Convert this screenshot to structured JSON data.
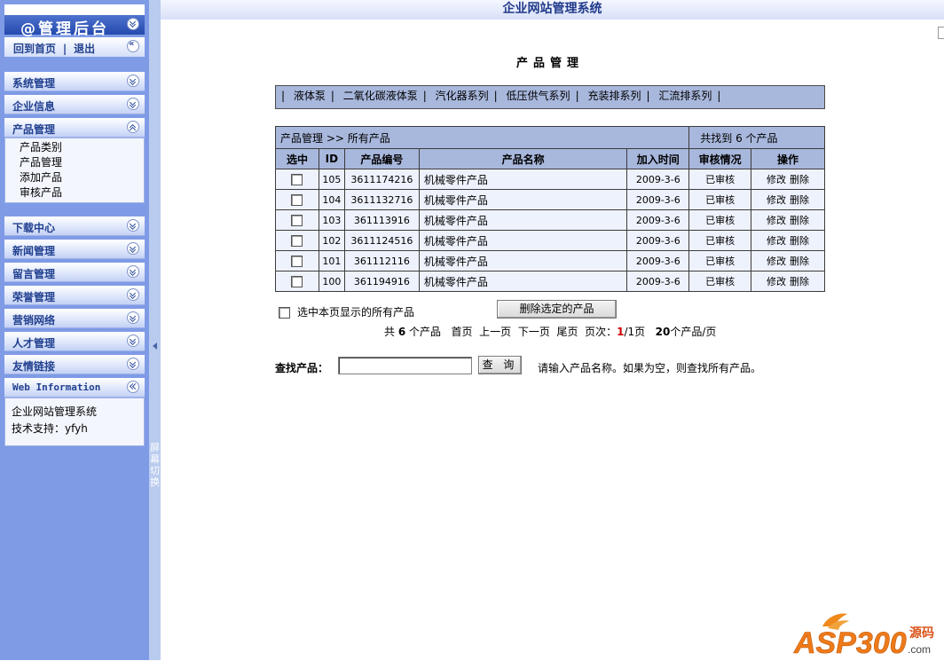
{
  "sidebar": {
    "title": "@管理后台",
    "home_links": [
      "回到首页",
      "|",
      "退出"
    ],
    "sections": [
      {
        "label": "系统管理"
      },
      {
        "label": "企业信息"
      },
      {
        "label": "产品管理",
        "items": [
          "产品类别",
          "产品管理",
          "添加产品",
          "审核产品"
        ]
      },
      {
        "label": "下载中心"
      },
      {
        "label": "新闻管理"
      },
      {
        "label": "留言管理"
      },
      {
        "label": "荣誉管理"
      },
      {
        "label": "营销网络"
      },
      {
        "label": "人才管理"
      },
      {
        "label": "友情链接"
      },
      {
        "label": "Web Information"
      }
    ],
    "info": [
      "企业网站管理系统",
      "技术支持：yfyh"
    ],
    "splitter_text": "屏幕切换"
  },
  "banner": "企业网站管理系统",
  "page_title": "产品管理",
  "categories": [
    "|",
    "液体泵",
    "|",
    "二氧化碳液体泵",
    "|",
    "汽化器系列",
    "|",
    "低压供气系列",
    "|",
    "充装排系列",
    "|",
    "汇流排系列",
    "|"
  ],
  "table": {
    "breadcrumb": "产品管理 >> 所有产品",
    "found": "共找到 6 个产品",
    "headers": [
      "选中",
      "ID",
      "产品编号",
      "产品名称",
      "加入时间",
      "审核情况",
      "操作"
    ],
    "rows": [
      {
        "id": "105",
        "code": "3611174216",
        "name": "机械零件产品",
        "date": "2009-3-6",
        "status": "已审核",
        "edit": "修改",
        "del": "删除"
      },
      {
        "id": "104",
        "code": "3611132716",
        "name": "机械零件产品",
        "date": "2009-3-6",
        "status": "已审核",
        "edit": "修改",
        "del": "删除"
      },
      {
        "id": "103",
        "code": "361113916",
        "name": "机械零件产品",
        "date": "2009-3-6",
        "status": "已审核",
        "edit": "修改",
        "del": "删除"
      },
      {
        "id": "102",
        "code": "3611124516",
        "name": "机械零件产品",
        "date": "2009-3-6",
        "status": "已审核",
        "edit": "修改",
        "del": "删除"
      },
      {
        "id": "101",
        "code": "361112116",
        "name": "机械零件产品",
        "date": "2009-3-6",
        "status": "已审核",
        "edit": "修改",
        "del": "删除"
      },
      {
        "id": "100",
        "code": "361194916",
        "name": "机械零件产品",
        "date": "2009-3-6",
        "status": "已审核",
        "edit": "修改",
        "del": "删除"
      }
    ]
  },
  "select_all_label": "选中本页显示的所有产品",
  "delete_button": "删除选定的产品",
  "pager": {
    "total_prefix": "共",
    "total": "6",
    "total_suffix": "个产品",
    "first": "首页",
    "prev": "上一页",
    "next": "下一页",
    "last": "尾页",
    "page_label": "页次：",
    "current": "1",
    "of": "/1页",
    "per_page_num": "20",
    "per_page_suffix": "个产品/页"
  },
  "search": {
    "label": "查找产品：",
    "button": "查 询",
    "hint": "请输入产品名称。如果为空，则查找所有产品。",
    "value": ""
  },
  "logo": {
    "text": "ASP300",
    "sub": "源码",
    "domain": ".com"
  }
}
